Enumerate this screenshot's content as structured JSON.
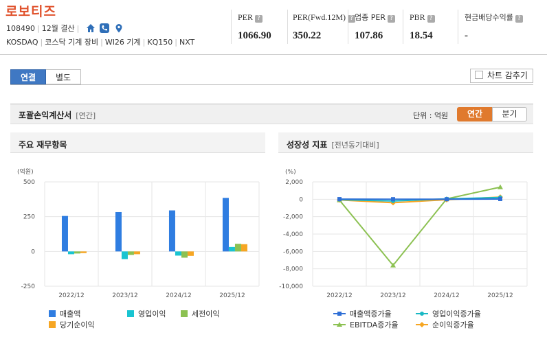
{
  "company": {
    "name": "로보티즈",
    "code": "108490",
    "settlement": "12월 결산",
    "tags": [
      "KOSDAQ",
      "코스닥 기계 장비",
      "WI26 기계",
      "KQ150",
      "NXT"
    ]
  },
  "indicators": [
    {
      "label": "PER",
      "value": "1066.90"
    },
    {
      "label": "PER(Fwd.12M)",
      "value": "350.22"
    },
    {
      "label": "업종 PER",
      "value": "107.86"
    },
    {
      "label": "PBR",
      "value": "18.54"
    },
    {
      "label": "현금배당수익률",
      "value": "-"
    }
  ],
  "tabs": {
    "consolidated": "연결",
    "separate": "별도"
  },
  "hide_chart_label": "차트 감추기",
  "section": {
    "title": "포괄손익계산서",
    "period_tag": "[연간]",
    "unit_label": "단위 : 억원",
    "annual": "연간",
    "quarterly": "분기"
  },
  "panels": {
    "left": {
      "title": "주요 재무항목"
    },
    "right": {
      "title": "성장성 지표",
      "sub": "[전년동기대비]"
    }
  },
  "colors": {
    "accent_orange": "#e07a2e",
    "tab_blue": "#3f78c3",
    "title_orange": "#e0512b"
  },
  "chart_data": [
    {
      "type": "bar",
      "unit_label": "(억원)",
      "categories": [
        "2022/12",
        "2023/12",
        "2024/12",
        "2025/12"
      ],
      "ylim": [
        -250,
        500
      ],
      "yticks": [
        500,
        250,
        0,
        -250
      ],
      "grid": true,
      "legend_position": "bottom",
      "series": [
        {
          "name": "매출액",
          "color": "#2f7de1",
          "values": [
            255,
            283,
            295,
            385
          ]
        },
        {
          "name": "영업이익",
          "color": "#19c4d1",
          "values": [
            -20,
            -55,
            -30,
            32
          ]
        },
        {
          "name": "세전이익",
          "color": "#8cc152",
          "values": [
            -15,
            -25,
            -45,
            55
          ]
        },
        {
          "name": "당기순이익",
          "color": "#f6a623",
          "values": [
            -12,
            -20,
            -32,
            52
          ]
        }
      ]
    },
    {
      "type": "line",
      "unit_label": "(%)",
      "categories": [
        "2022/12",
        "2023/12",
        "2024/12",
        "2025/12"
      ],
      "ylim": [
        -10000,
        2000
      ],
      "yticks": [
        2000,
        0,
        -2000,
        -4000,
        -6000,
        -8000,
        -10000
      ],
      "ytick_labels": [
        "2,000",
        "0",
        "-2,000",
        "-4,000",
        "-6,000",
        "-8,000",
        "-10,000"
      ],
      "grid": true,
      "legend_position": "bottom",
      "series": [
        {
          "name": "매출액증가율",
          "color": "#2f6fd6",
          "marker": "square",
          "values": [
            20,
            10,
            5,
            30
          ]
        },
        {
          "name": "영업이익증가율",
          "color": "#19b8c4",
          "marker": "circle",
          "values": [
            -40,
            -200,
            50,
            200
          ]
        },
        {
          "name": "EBITDA증가율",
          "color": "#8cc152",
          "marker": "triangle",
          "values": [
            -100,
            -7600,
            40,
            1400
          ]
        },
        {
          "name": "순이익증가율",
          "color": "#f6a623",
          "marker": "diamond",
          "values": [
            -80,
            -400,
            -50,
            250
          ]
        }
      ]
    }
  ]
}
